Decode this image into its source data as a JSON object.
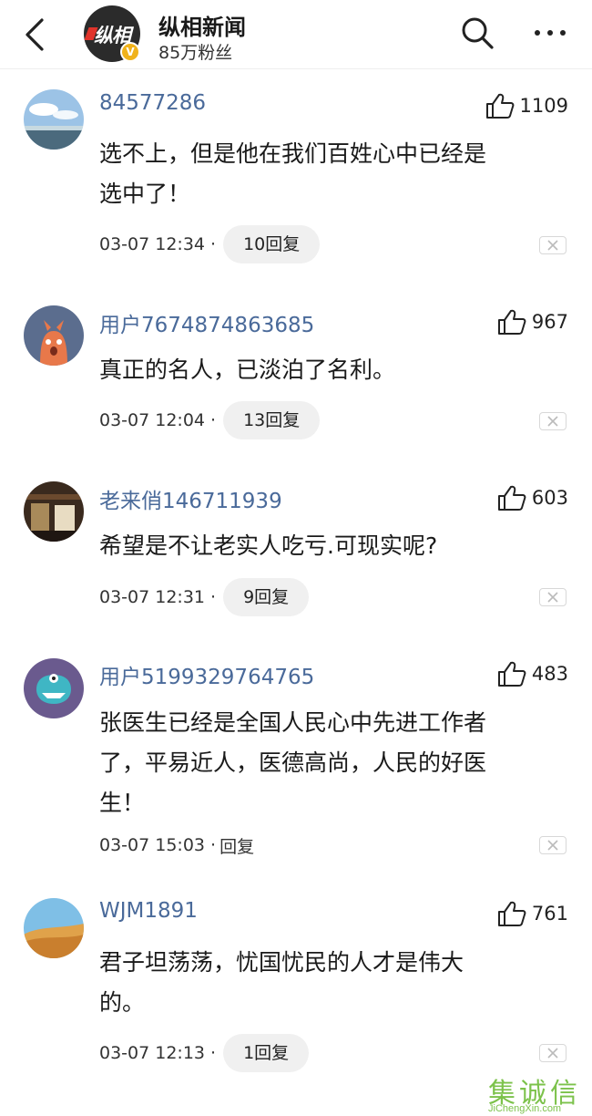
{
  "header": {
    "title": "纵相新闻",
    "followers": "85万粉丝",
    "logo_text": "纵相",
    "verified_badge": "V"
  },
  "comments": [
    {
      "username": "84577286",
      "likes": "1109",
      "text_lines": [
        "选不上，但是他在我们百姓心中已经是",
        "选中了！"
      ],
      "time": "03-07 12:34 ·",
      "reply": "10回复"
    },
    {
      "username": "用户7674874863685",
      "likes": "967",
      "text_lines": [
        "真正的名人，已淡泊了名利。"
      ],
      "time": "03-07 12:04 ·",
      "reply": "13回复"
    },
    {
      "username": "老来俏146711939",
      "likes": "603",
      "text_lines": [
        "希望是不让老实人吃亏.可现实呢?"
      ],
      "time": "03-07 12:31 ·",
      "reply": "9回复"
    },
    {
      "username": "用户5199329764765",
      "likes": "483",
      "text_lines": [
        "张医生已经是全国人民心中先进工作者",
        "了，平易近人，医德高尚，人民的好医",
        "生！"
      ],
      "time": "03-07 15:03 ·",
      "reply": "回复"
    },
    {
      "username": "WJM1891",
      "likes": "761",
      "text_lines": [
        "君子坦荡荡，忧国忧民的人才是伟大",
        "的。"
      ],
      "time": "03-07 12:13 ·",
      "reply": "1回复"
    }
  ],
  "watermark": {
    "text": "集诚信",
    "url": "JiChengXin.com"
  },
  "colors": {
    "username": "#4a6a9a",
    "pill": "#f0f0f0",
    "watermark": "#7cc24b",
    "badge": "#f0b21a"
  }
}
